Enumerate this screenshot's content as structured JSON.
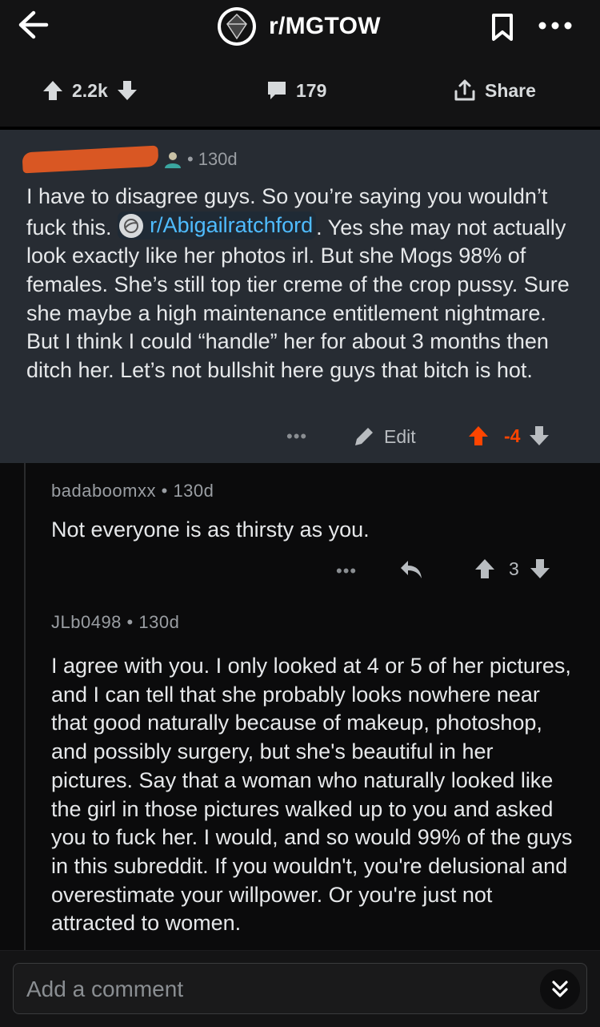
{
  "header": {
    "subreddit": "r/MGTOW"
  },
  "post_actions": {
    "upvotes": "2.2k",
    "comments": "179",
    "share_label": "Share"
  },
  "highlighted_comment": {
    "time": "130d",
    "dot": "•",
    "text_before_link": "I have to disagree guys. So you’re saying you wouldn’t fuck this.",
    "link_text": "r/Abigailratchford",
    "text_after_link": ". Yes she may not actually look exactly like her photos irl. But she Mogs 98% of females. She’s still top tier creme of the crop pussy.  Sure she maybe a high maintenance entitlement nightmare. But I think I could “handle” her for about 3 months then ditch her. Let’s not bullshit here guys that bitch is hot.",
    "more_label": "•••",
    "edit_label": "Edit",
    "score": "-4",
    "accent_color": "#ff4500"
  },
  "replies": [
    {
      "author": "badaboomxx",
      "dot": "•",
      "time": "130d",
      "text": "Not everyone is as thirsty as you.",
      "more_label": "•••",
      "score": "3"
    },
    {
      "author": "JLb0498",
      "dot": "•",
      "time": "130d",
      "text": "I agree with you. I only looked at 4 or 5 of her pictures, and I can tell that she probably looks nowhere near that good naturally because of makeup, photoshop, and possibly surgery, but she's beautiful in her pictures. Say that a woman who naturally looked like the girl in those pictures walked up to you and asked you to fuck her. I would, and so would 99% of the guys in this subreddit. If you wouldn't, you're delusional and overestimate your willpower. Or you're just not attracted to women."
    }
  ],
  "composer": {
    "placeholder": "Add a comment"
  }
}
